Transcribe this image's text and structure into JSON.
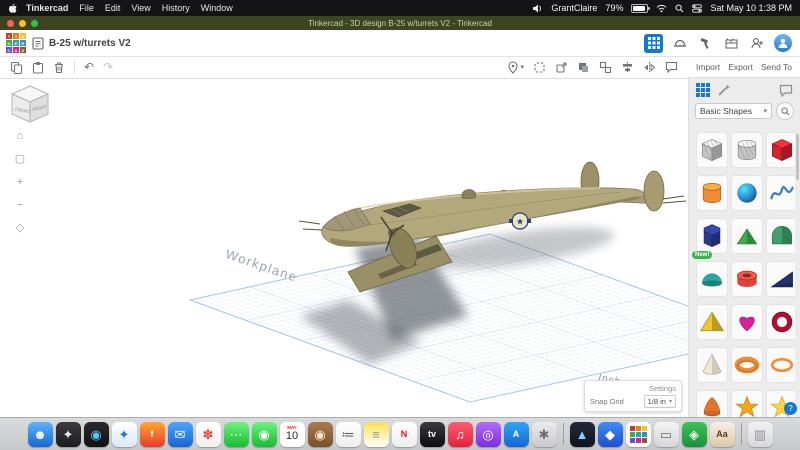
{
  "menu_bar": {
    "items": [
      "Tinkercad",
      "File",
      "Edit",
      "View",
      "History",
      "Window"
    ],
    "status": {
      "user": "GrantClaire",
      "battery_percent": "79%",
      "clock": "Sat May 10  1:38 PM"
    }
  },
  "window": {
    "title": "Tinkercad - 3D design B-25 w/turrets V2 - Tinkercad"
  },
  "header": {
    "design_name": "B-25 w/turrets V2",
    "logo_letters": [
      "T",
      "I",
      "N",
      "K",
      "E",
      "R",
      "C",
      "A",
      "D"
    ],
    "logo_colors": [
      "#d0342c",
      "#e87b1e",
      "#f2c12e",
      "#3fae49",
      "#2aa7a0",
      "#2e8fd5",
      "#6a4fd0",
      "#d6219c",
      "#8a5a2b"
    ]
  },
  "toolbar": {
    "actions": [
      {
        "label": "Import"
      },
      {
        "label": "Export"
      },
      {
        "label": "Send To"
      }
    ]
  },
  "icons": {
    "caret_down": "▾",
    "undo": "↶",
    "redo": "↷",
    "home": "⌂",
    "fit": "▢",
    "zoom_in": "+",
    "zoom_out": "−",
    "perspective": "◇",
    "help": "?"
  },
  "canvas": {
    "workplane_label": "Workplane",
    "units_label": "Inches",
    "viewcube": {
      "front": "FRONT",
      "right": "RIGHT"
    },
    "settings": {
      "title": "Settings",
      "snap_label": "Snap Grid",
      "snap_value": "1/8 in"
    },
    "accent_grid_color": "#bcd6ef"
  },
  "panel": {
    "category": "Basic Shapes",
    "shapes": [
      {
        "name": "box-hole",
        "type": "cube",
        "color": "#c4c4c4",
        "hatch": true
      },
      {
        "name": "cylinder-hole",
        "type": "cylinder",
        "color": "#c4c4c4",
        "hatch": true
      },
      {
        "name": "box",
        "type": "cube",
        "color": "#d2232e"
      },
      {
        "name": "cylinder",
        "type": "cylinder",
        "color": "#f18a33"
      },
      {
        "name": "sphere",
        "type": "sphere",
        "color": "#2e8fd5"
      },
      {
        "name": "scribble",
        "type": "scribble",
        "color": "#3a7bd5"
      },
      {
        "name": "polygon",
        "type": "prism",
        "color": "#2b3a8f",
        "badge": "New!"
      },
      {
        "name": "roof",
        "type": "roof",
        "color": "#3fae49"
      },
      {
        "name": "round-roof",
        "type": "roundroof",
        "color": "#41a06c"
      },
      {
        "name": "half-sphere",
        "type": "halfsphere",
        "color": "#2aa7a0"
      },
      {
        "name": "tube",
        "type": "tube",
        "color": "#d9453a"
      },
      {
        "name": "wedge",
        "type": "wedge",
        "color": "#23306e"
      },
      {
        "name": "pyramid",
        "type": "pyramid",
        "color": "#f2c52e"
      },
      {
        "name": "heart",
        "type": "heart",
        "color": "#d6219c"
      },
      {
        "name": "ring",
        "type": "ring",
        "color": "#b01030"
      },
      {
        "name": "cone",
        "type": "cone",
        "color": "#efe9d4"
      },
      {
        "name": "torus",
        "type": "torus",
        "color": "#f18a33"
      },
      {
        "name": "torus-thin",
        "type": "torusthin",
        "color": "#f18a33"
      },
      {
        "name": "paraboloid",
        "type": "paraboloid",
        "color": "#e8742a"
      },
      {
        "name": "star-orange",
        "type": "star",
        "color": "#f2a71b"
      },
      {
        "name": "star",
        "type": "star",
        "color": "#ffd23e"
      }
    ]
  },
  "dock": {
    "items": [
      {
        "name": "finder",
        "glyph": "☻",
        "fg": "#ffffff",
        "c1": "#5fb2f9",
        "c2": "#1567d3"
      },
      {
        "name": "launchpad",
        "glyph": "✦",
        "fg": "#e8e8e8",
        "c1": "#3c3c3e",
        "c2": "#1c1c1e"
      },
      {
        "name": "siri",
        "glyph": "◉",
        "fg": "#52c7f5",
        "c1": "#2a2a2c",
        "c2": "#111113"
      },
      {
        "name": "safari",
        "glyph": "✦",
        "fg": "#1e6ef0",
        "c1": "#ffffff",
        "c2": "#d9e8fb"
      },
      {
        "name": "firefox",
        "glyph": "f",
        "type": "text",
        "fg": "#ffffff",
        "c1": "#ffa72e",
        "c2": "#e83b2d"
      },
      {
        "name": "mail",
        "glyph": "✉",
        "fg": "#ffffff",
        "c1": "#4ca5f9",
        "c2": "#1567d3"
      },
      {
        "name": "photos",
        "glyph": "✽",
        "fg": "#e8453c",
        "c1": "#ffffff",
        "c2": "#efefef"
      },
      {
        "name": "messages",
        "glyph": "⋯",
        "fg": "#ffffff",
        "c1": "#6cf37f",
        "c2": "#17bd2e"
      },
      {
        "name": "facetime",
        "glyph": "◉",
        "fg": "#ffffff",
        "c1": "#6cf37f",
        "c2": "#17bd2e"
      },
      {
        "name": "calendar",
        "type": "calendar",
        "month": "MAY",
        "day": "10"
      },
      {
        "name": "photo-booth",
        "glyph": "◉",
        "fg": "#ffe9c9",
        "c1": "#a97b4f",
        "c2": "#7a4f2a"
      },
      {
        "name": "reminders",
        "glyph": "≔",
        "fg": "#555555",
        "c1": "#ffffff",
        "c2": "#ededed"
      },
      {
        "name": "notes",
        "glyph": "≡",
        "fg": "#9a9a9a",
        "c1": "#ffe054",
        "c2": "#ffffff"
      },
      {
        "name": "news",
        "glyph": "N",
        "type": "text",
        "fg": "#e0162b",
        "c1": "#ffffff",
        "c2": "#ededed"
      },
      {
        "name": "tv",
        "glyph": "tv",
        "type": "text",
        "fg": "#ffffff",
        "c1": "#3a3a3c",
        "c2": "#0d0d0f"
      },
      {
        "name": "music",
        "glyph": "♫",
        "fg": "#ffffff",
        "c1": "#fb5c74",
        "c2": "#e3223b"
      },
      {
        "name": "podcasts",
        "glyph": "◎",
        "fg": "#ffffff",
        "c1": "#b06cf5",
        "c2": "#7b2ee0"
      },
      {
        "name": "app-store",
        "glyph": "A",
        "type": "text",
        "fg": "#ffffff",
        "c1": "#30a5f7",
        "c2": "#1567d3"
      },
      {
        "name": "settings",
        "glyph": "✱",
        "fg": "#6e6e73",
        "c1": "#ececec",
        "c2": "#c9c9ce"
      },
      {
        "type": "divider"
      },
      {
        "name": "prism-app",
        "glyph": "▲",
        "fg": "#7fd0ff",
        "c1": "#23283a",
        "c2": "#10131f"
      },
      {
        "name": "cad-cube",
        "glyph": "◆",
        "fg": "#ffffff",
        "c1": "#3f8cf3",
        "c2": "#1d4fd0"
      },
      {
        "name": "tinkercad",
        "type": "tinkergrid"
      },
      {
        "name": "window-app",
        "glyph": "▭",
        "fg": "#6e6e73",
        "c1": "#f4f4f4",
        "c2": "#d6d6d8"
      },
      {
        "name": "sheets-app",
        "glyph": "◈",
        "fg": "#ffffff",
        "c1": "#3ec256",
        "c2": "#1b9138"
      },
      {
        "name": "dictionary",
        "glyph": "Aa",
        "type": "text",
        "fg": "#5b3a1e",
        "c1": "#f7f0e4",
        "c2": "#dcc8a8"
      },
      {
        "type": "divider"
      },
      {
        "name": "trash",
        "glyph": "▥",
        "fg": "#8e8e93",
        "c1": "#f2f2f4",
        "c2": "#d8d8dc"
      }
    ]
  }
}
